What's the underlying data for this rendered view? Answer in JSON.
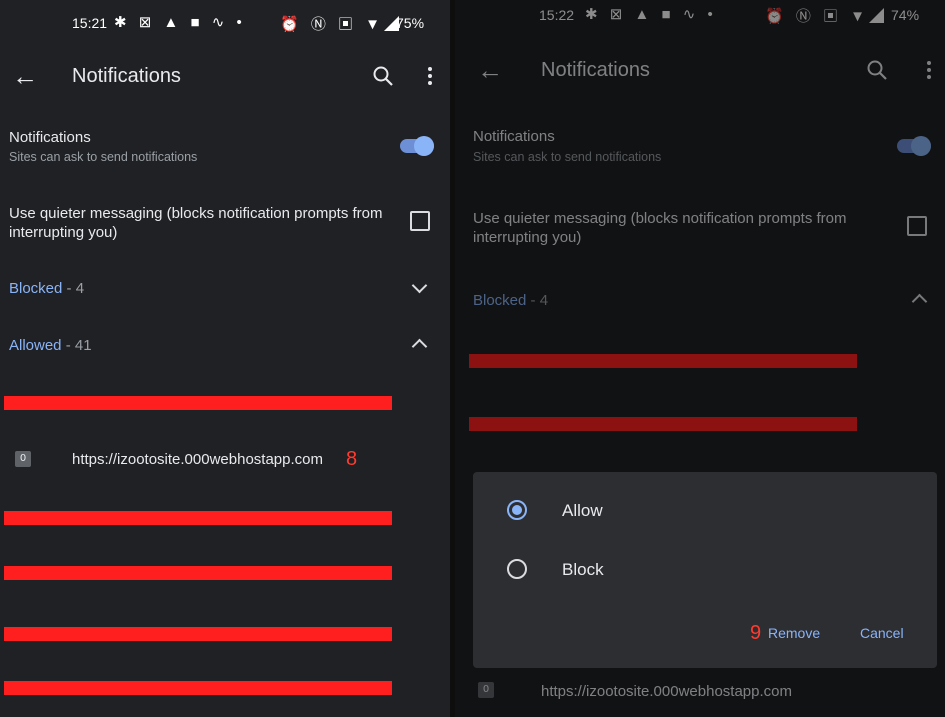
{
  "left": {
    "status": {
      "time": "15:21",
      "battery": "75%"
    },
    "appbar": {
      "title": "Notifications"
    },
    "notifications_row": {
      "title": "Notifications",
      "subtitle": "Sites can ask to send notifications",
      "enabled": true
    },
    "quieter_row": {
      "title": "Use quieter messaging (blocks notification prompts from interrupting you)",
      "checked": false
    },
    "blocked_section": {
      "label": "Blocked",
      "count": " - 4",
      "expanded": false
    },
    "allowed_section": {
      "label": "Allowed",
      "count": " - 41",
      "expanded": true
    },
    "site_row": {
      "favicon_letter": "0",
      "url": "https://izootosite.000webhostapp.com",
      "annotation": "8"
    }
  },
  "right": {
    "status": {
      "time": "15:22",
      "battery": "74%"
    },
    "appbar": {
      "title": "Notifications"
    },
    "notifications_row": {
      "title": "Notifications",
      "subtitle": "Sites can ask to send notifications",
      "enabled": true
    },
    "quieter_row": {
      "title": "Use quieter messaging (blocks notification prompts from interrupting you)",
      "checked": false
    },
    "blocked_section": {
      "label": "Blocked",
      "count": " - 4",
      "expanded": true
    },
    "dialog": {
      "options": [
        {
          "label": "Allow",
          "selected": true
        },
        {
          "label": "Block",
          "selected": false
        }
      ],
      "remove_label": "Remove",
      "cancel_label": "Cancel",
      "annotation": "9"
    },
    "site_row": {
      "favicon_letter": "0",
      "url": "https://izootosite.000webhostapp.com"
    }
  },
  "status_icons": "✱ ⊠ ▲ ■ ∿ •",
  "status_right_icons": "⏰ Ⓝ ▣ ▼◢",
  "colors": {
    "accent": "#8ab4f8",
    "annotation": "#ff3b30",
    "redaction": "#ff1f1f",
    "background": "#202124"
  }
}
